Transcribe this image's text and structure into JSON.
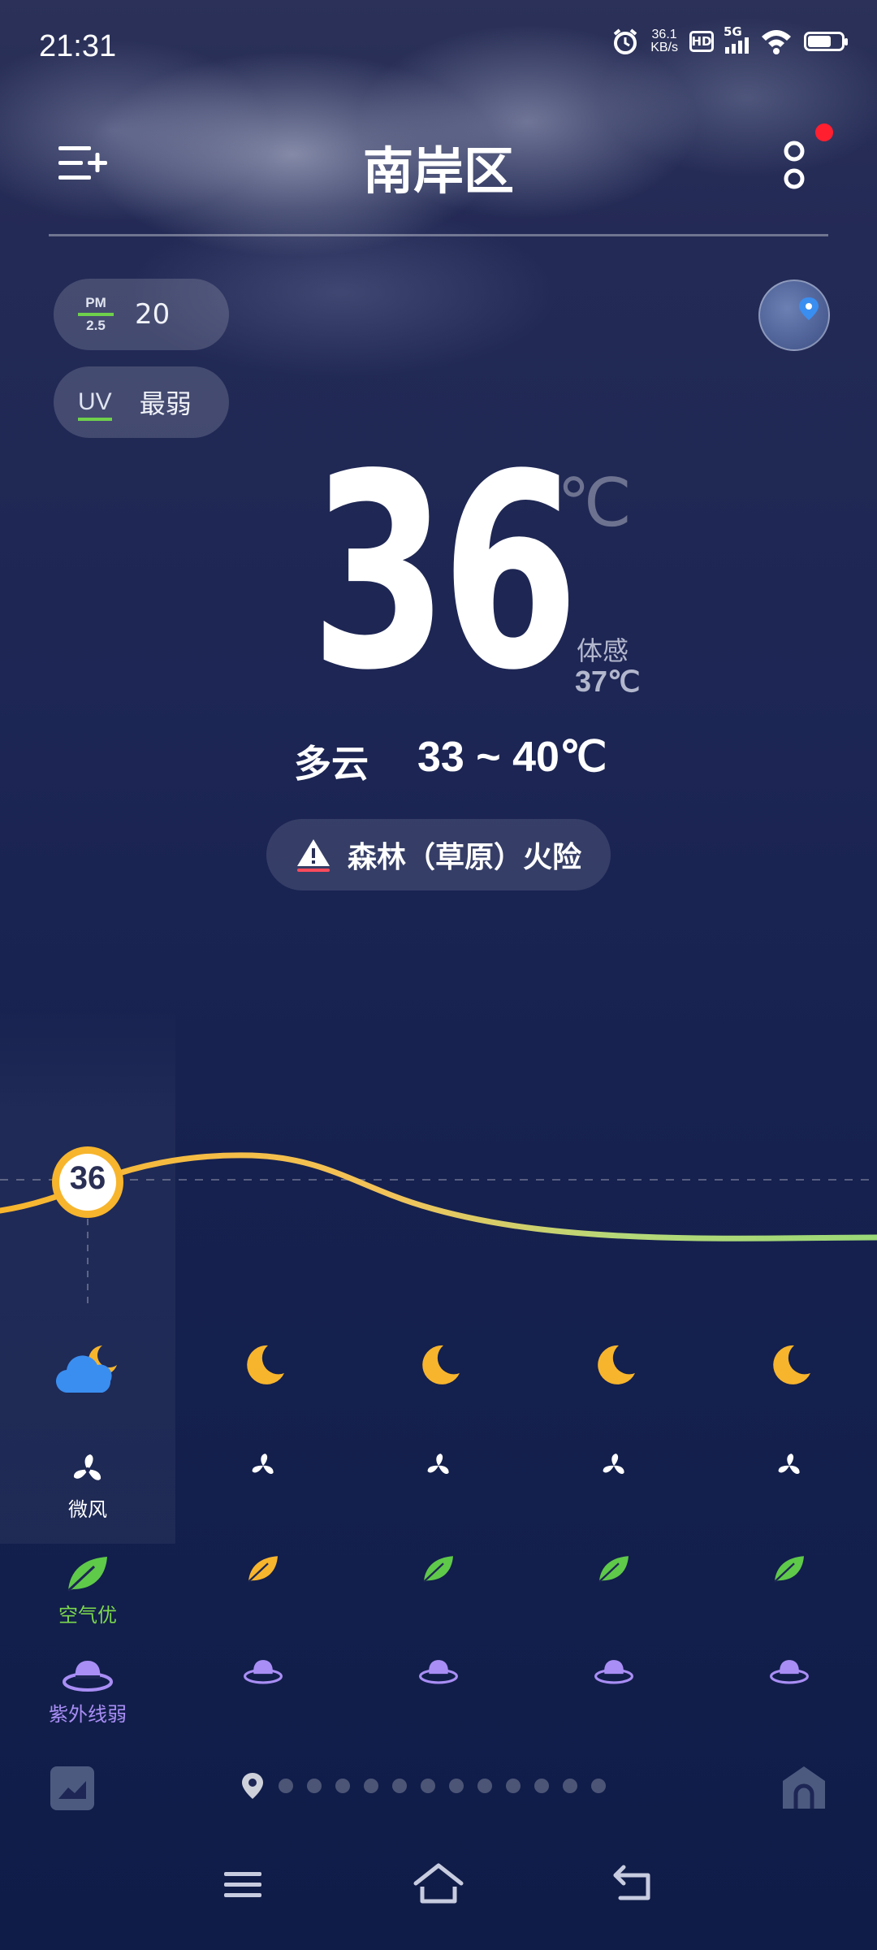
{
  "status_bar": {
    "time": "21:31",
    "net_speed_value": "36.1",
    "net_speed_unit": "KB/s",
    "hd": "HD",
    "network": "5G"
  },
  "header": {
    "location": "南岸区"
  },
  "chips": {
    "pm_label_top": "PM",
    "pm_label_bottom": "2.5",
    "pm_value": "20",
    "uv_label": "UV",
    "uv_value": "最弱"
  },
  "current": {
    "temperature": "36",
    "unit": "℃",
    "feels_label": "体感",
    "feels_value": "37℃",
    "condition": "多云",
    "range": "33 ~ 40℃"
  },
  "alert": {
    "text": "森林（草原）火险"
  },
  "hourly": {
    "current_temp_badge": "36",
    "weather_icons": [
      "cloudy-night-icon",
      "moon-icon",
      "moon-icon",
      "moon-icon",
      "moon-icon"
    ],
    "wind_label": "微风",
    "air_label": "空气优",
    "uv_label": "紫外线弱"
  },
  "pager": {
    "page_count": 12
  },
  "colors": {
    "accent_orange": "#f7b52d",
    "air_green": "#7bd84d",
    "uv_purple": "#a98ef5",
    "alert_red": "#ff4b5c",
    "notification_red": "#ff1f2f"
  }
}
